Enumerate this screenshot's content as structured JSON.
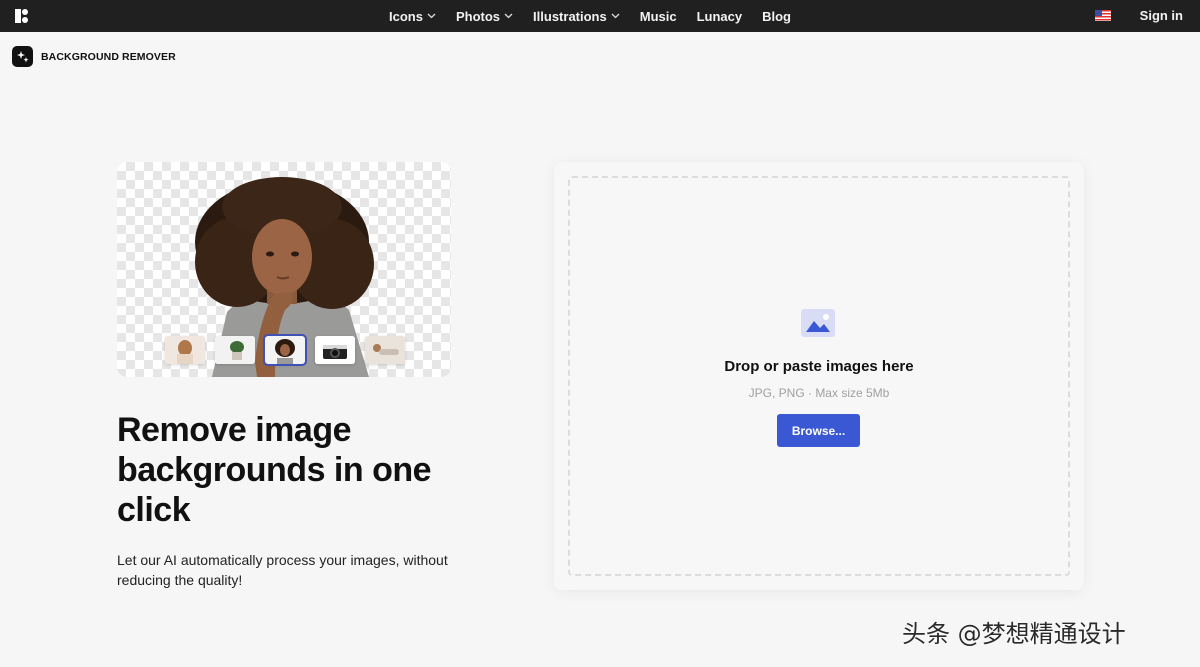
{
  "nav": {
    "items": [
      {
        "label": "Icons",
        "dropdown": true
      },
      {
        "label": "Photos",
        "dropdown": true
      },
      {
        "label": "Illustrations",
        "dropdown": true
      },
      {
        "label": "Music",
        "dropdown": false
      },
      {
        "label": "Lunacy",
        "dropdown": false
      },
      {
        "label": "Blog",
        "dropdown": false
      }
    ],
    "signin_label": "Sign in",
    "language_flag": "us-flag-icon"
  },
  "brand": {
    "name": "BACKGROUND REMOVER"
  },
  "hero": {
    "headline": "Remove image backgrounds in one click",
    "subtext": "Let our AI automatically process your images, without reducing the quality!",
    "thumbnails": [
      "woman-photo",
      "plant-photo",
      "girl-photo",
      "camera-photo",
      "person-lying-photo"
    ],
    "active_thumbnail": 2
  },
  "upload": {
    "title": "Drop or paste images here",
    "hint": "JPG, PNG · Max size 5Mb",
    "button_label": "Browse..."
  },
  "watermark": "头条 @梦想精通设计",
  "colors": {
    "topbar": "#202020",
    "accent": "#3a58d3",
    "background": "#f6f6f6"
  }
}
